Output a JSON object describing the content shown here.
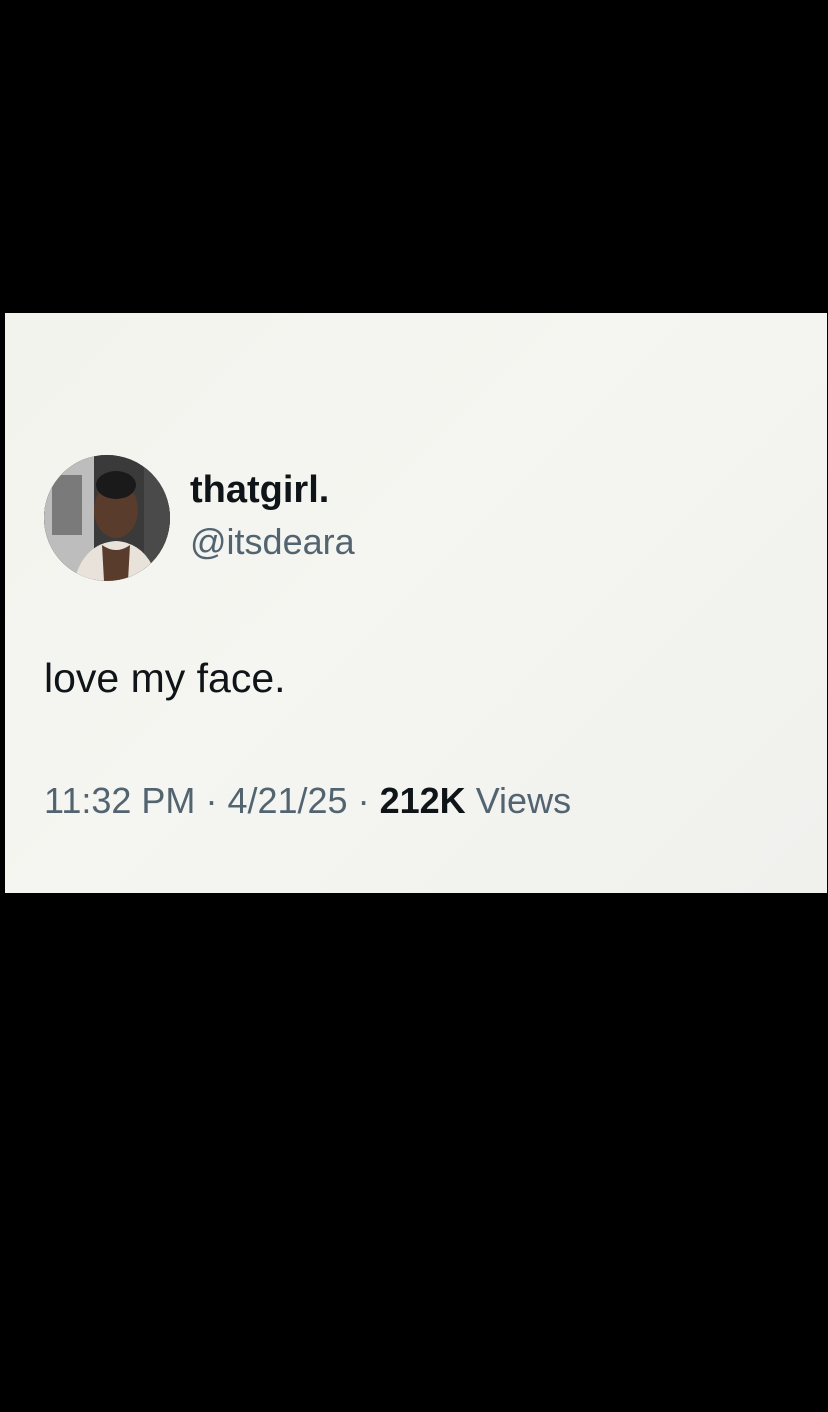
{
  "tweet": {
    "display_name": "thatgirl.",
    "handle": "@itsdeara",
    "text": "love my face.",
    "time": "11:32 PM",
    "separator": "·",
    "date": "4/21/25",
    "views_count": "212K",
    "views_label": "Views"
  },
  "colors": {
    "background": "#000000",
    "card": "#f4f4f0",
    "primary_text": "#0f1419",
    "secondary_text": "#536471"
  }
}
